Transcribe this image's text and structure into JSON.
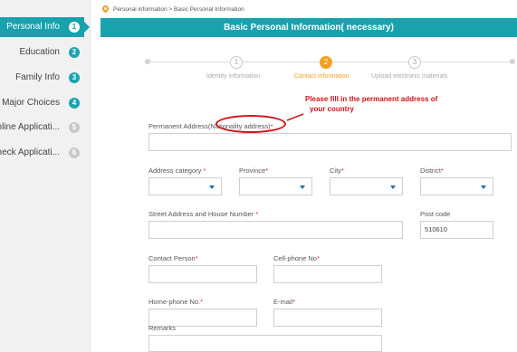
{
  "sidebar": {
    "items": [
      {
        "label": "Personal Info",
        "num": "1"
      },
      {
        "label": "Education",
        "num": "2"
      },
      {
        "label": "Family Info",
        "num": "3"
      },
      {
        "label": "Major Choices",
        "num": "4"
      },
      {
        "label": "Online Applicati...",
        "num": "5"
      },
      {
        "label": "Check Applicati...",
        "num": "6"
      }
    ]
  },
  "breadcrumb": {
    "text": "Personal information > Basic Personal Information"
  },
  "header": {
    "title": "Basic Personal Information( necessary)"
  },
  "steps": [
    {
      "num": "1",
      "label": "Identity information"
    },
    {
      "num": "2",
      "label": "Contact information"
    },
    {
      "num": "3",
      "label": "Upload electronic materials"
    }
  ],
  "form": {
    "permanent_address": {
      "label": "Permanent Address(Nationality address)",
      "req": "*",
      "value": ""
    },
    "address_category": {
      "label": "Address category",
      "req": " *",
      "value": ""
    },
    "province": {
      "label": "Province",
      "req": "*",
      "value": ""
    },
    "city": {
      "label": "City",
      "req": "*",
      "value": ""
    },
    "district": {
      "label": "District",
      "req": "*",
      "value": ""
    },
    "street": {
      "label": "Street Address and House Number",
      "req": " *",
      "value": ""
    },
    "postcode": {
      "label": "Post code",
      "value": "510610"
    },
    "contact_person": {
      "label": "Contact Person",
      "req": "*",
      "value": ""
    },
    "cellphone": {
      "label": "Cell-phone No",
      "req": "*",
      "value": ""
    },
    "homephone": {
      "label": "Home-phone No.",
      "req": "*",
      "value": ""
    },
    "email": {
      "label": "E-mail",
      "req": "*",
      "value": ""
    },
    "remarks": {
      "label": "Remarks",
      "value": ""
    }
  },
  "annotation": {
    "line1": "Please fill in the permanent address of",
    "line2": "your country"
  },
  "colors": {
    "accent": "#19a1ae",
    "step_active": "#f5a021",
    "required": "#e0312b",
    "annotation": "#d0131b"
  }
}
